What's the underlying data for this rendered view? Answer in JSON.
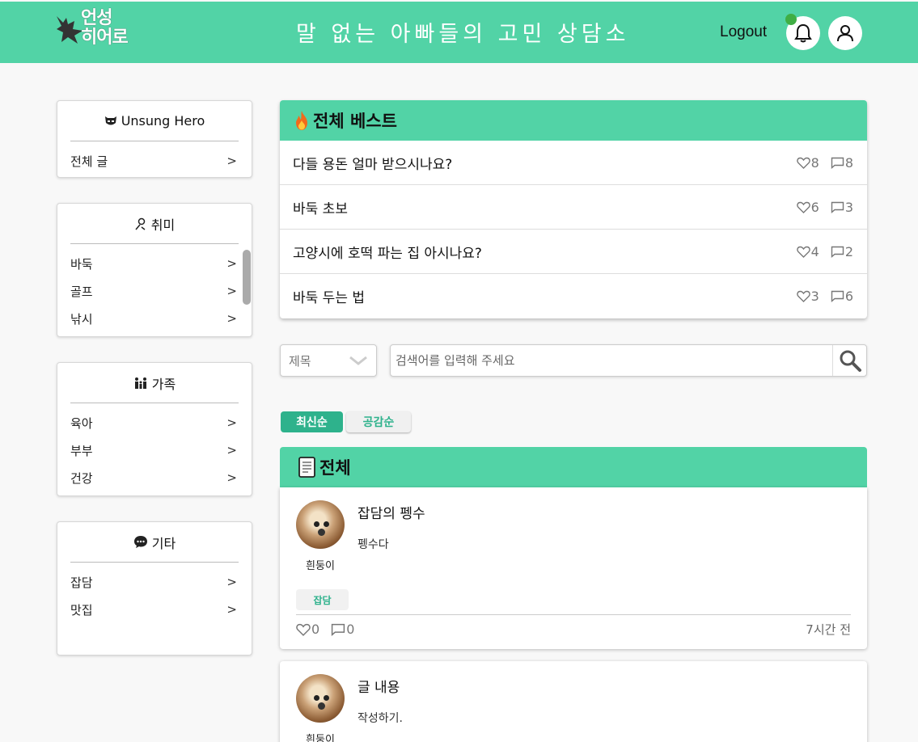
{
  "header": {
    "logo_line1": "언성",
    "logo_line2": "히어로",
    "title": "말 없는 아빠들의 고민 상담소",
    "logout": "Logout"
  },
  "sidebar": {
    "sections": [
      {
        "title": "Unsung Hero",
        "icon": "mask-icon",
        "items": [
          {
            "label": "전체 글"
          }
        ]
      },
      {
        "title": "취미",
        "icon": "person-icon",
        "items": [
          {
            "label": "바둑"
          },
          {
            "label": "골프"
          },
          {
            "label": "낚시"
          }
        ]
      },
      {
        "title": "가족",
        "icon": "family-icon",
        "items": [
          {
            "label": "육아"
          },
          {
            "label": "부부"
          },
          {
            "label": "건강"
          }
        ]
      },
      {
        "title": "기타",
        "icon": "chat-bubble-icon",
        "items": [
          {
            "label": "잡담"
          },
          {
            "label": "맛집"
          }
        ]
      }
    ]
  },
  "best": {
    "title": "전체 베스트",
    "icon": "fire-icon",
    "rows": [
      {
        "title": "다들 용돈 얼마 받으시나요?",
        "likes": "8",
        "comments": "8"
      },
      {
        "title": "바둑 초보",
        "likes": "6",
        "comments": "3"
      },
      {
        "title": "고양시에 호떡 파는 집 아시나요?",
        "likes": "4",
        "comments": "2"
      },
      {
        "title": "바둑 두는 법",
        "likes": "3",
        "comments": "6"
      }
    ]
  },
  "search": {
    "select_value": "제목",
    "placeholder": "검색어를 입력해 주세요"
  },
  "sort": {
    "newest": "최신순",
    "likes": "공감순"
  },
  "all": {
    "title": "전체",
    "icon": "document-icon",
    "posts": [
      {
        "author": "흰둥이",
        "title": "잡담의 펭수",
        "body": "펭수다",
        "tag": "잡담",
        "likes": "0",
        "comments": "0",
        "time": "7시간 전"
      },
      {
        "author": "흰둥이",
        "title": "글 내용",
        "body": "작성하기."
      }
    ]
  },
  "colors": {
    "brand": "#52d3a6",
    "accent": "#2eb28c",
    "notification": "#3fae44"
  }
}
